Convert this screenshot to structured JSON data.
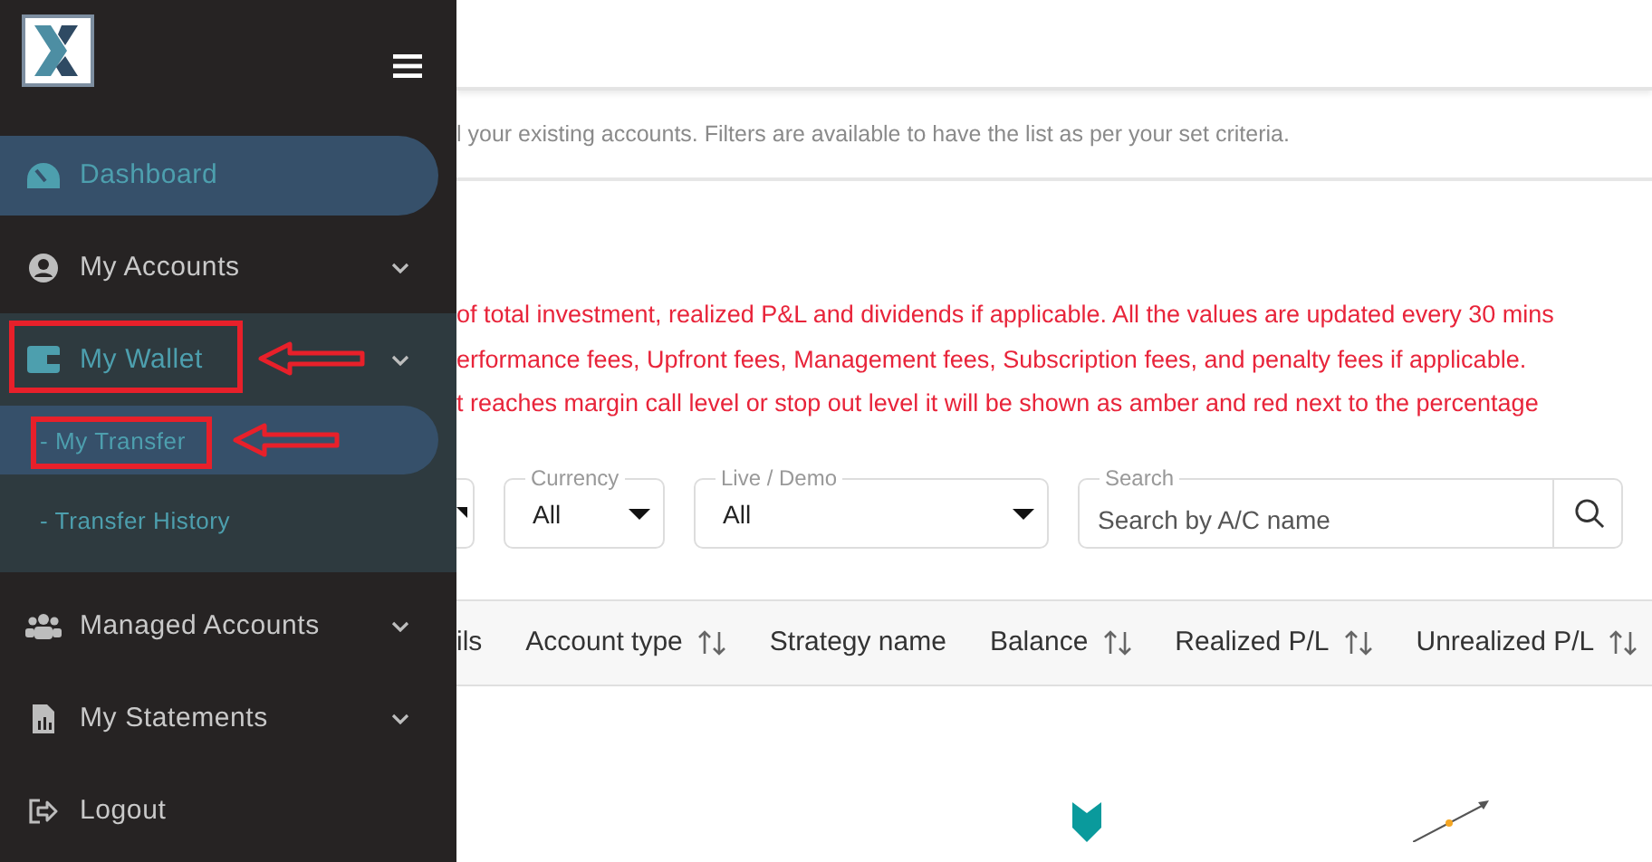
{
  "sidebar": {
    "items": [
      {
        "kind": "item",
        "label": "Dashboard",
        "selected": true,
        "expandable": false,
        "annotated": false
      },
      {
        "kind": "item",
        "label": "My Accounts",
        "selected": false,
        "expandable": true,
        "annotated": false
      },
      {
        "kind": "group",
        "label": "My Wallet",
        "selected": false,
        "expandable": true,
        "annotated": true,
        "children": [
          {
            "label": "- My Transfer",
            "selected": true,
            "annotated": true
          },
          {
            "label": "- Transfer History",
            "selected": false,
            "annotated": false
          }
        ]
      },
      {
        "kind": "item",
        "label": "Managed Accounts",
        "selected": false,
        "expandable": true,
        "annotated": false
      },
      {
        "kind": "item",
        "label": "My Statements",
        "selected": false,
        "expandable": true,
        "annotated": false
      },
      {
        "kind": "item",
        "label": "Logout",
        "selected": false,
        "expandable": false,
        "annotated": false
      }
    ]
  },
  "description": "l your existing accounts. Filters are available to have the list as per your set criteria.",
  "notes": [
    "of total investment, realized P&L and dividends if applicable. All the values are updated every 30 mins",
    "erformance fees, Upfront fees, Management fees, Subscription fees, and penalty fees if applicable.",
    "t reaches margin call level or stop out level it will be shown as amber and red next to the percentage"
  ],
  "filters": [
    {
      "kind": "partial"
    },
    {
      "kind": "select",
      "label": "Currency",
      "value": "All"
    },
    {
      "kind": "select",
      "label": "Live / Demo",
      "value": "All"
    },
    {
      "kind": "search",
      "label": "Search",
      "placeholder": "Search by A/C name"
    }
  ],
  "table": {
    "columns": [
      {
        "label": "ils",
        "sortable": false
      },
      {
        "label": "Account type",
        "sortable": true
      },
      {
        "label": "Strategy name",
        "sortable": false
      },
      {
        "label": "Balance",
        "sortable": true
      },
      {
        "label": "Realized P/L",
        "sortable": true
      },
      {
        "label": "Unrealized P/L",
        "sortable": true
      }
    ]
  }
}
